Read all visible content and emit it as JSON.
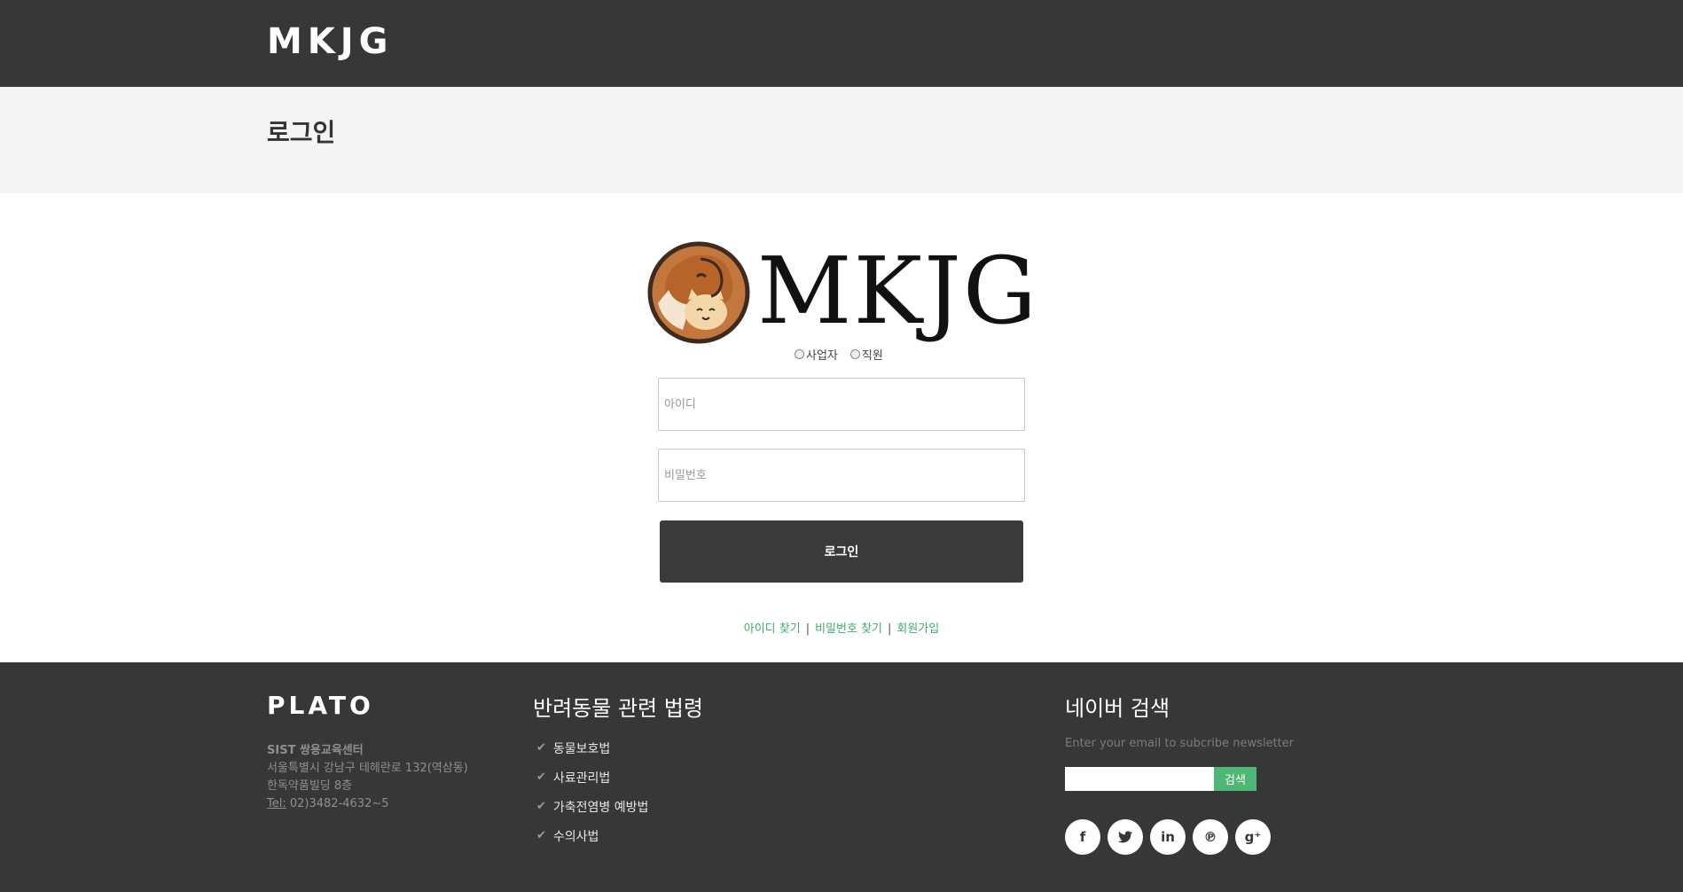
{
  "header": {
    "brand": "MKJG"
  },
  "page": {
    "title": "로그인"
  },
  "login": {
    "logo_text": "MKJG",
    "roles": [
      {
        "label": "사업자"
      },
      {
        "label": "직원"
      }
    ],
    "id_placeholder": "아이디",
    "password_placeholder": "비밀번호",
    "submit_label": "로그인",
    "links": {
      "find_id": "아이디 찾기",
      "find_password": "비밀번호 찾기",
      "signup": "회원가입",
      "separator": "|"
    }
  },
  "footer": {
    "brand": "PLATO",
    "address": {
      "org": "SIST 쌍용교육센터",
      "line1": "서울특별시 강남구 테헤란로 132(역삼동)",
      "line2": "한독약품빌딩 8층",
      "tel_label": "Tel:",
      "tel_value": " 02)3482-4632~5"
    },
    "laws": {
      "title": "반려동물 관련 법령",
      "items": [
        {
          "label": "동물보호법"
        },
        {
          "label": "사료관리법"
        },
        {
          "label": "가축전염병 예방법"
        },
        {
          "label": "수의사법"
        }
      ]
    },
    "search": {
      "title": "네이버 검색",
      "subtitle": "Enter your email to subcribe newsletter",
      "button_label": "검색"
    },
    "socials": [
      {
        "icon": "facebook-icon",
        "glyph": "f"
      },
      {
        "icon": "twitter-icon",
        "glyph": "🐦"
      },
      {
        "icon": "linkedin-icon",
        "glyph": "in"
      },
      {
        "icon": "pinterest-icon",
        "glyph": "℗"
      },
      {
        "icon": "google-plus-icon",
        "glyph": "g⁺"
      }
    ]
  }
}
